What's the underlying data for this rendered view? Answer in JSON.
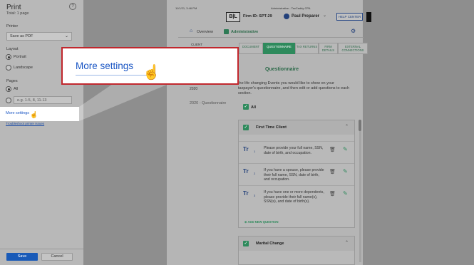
{
  "print_dialog": {
    "title": "Print",
    "total": "Total: 1 page",
    "help_icon": "?",
    "printer_label": "Printer",
    "printer_value": "Save as PDF",
    "layout_label": "Layout",
    "layout_options": [
      "Portrait",
      "Landscape"
    ],
    "layout_selected": "Portrait",
    "pages_label": "Pages",
    "pages_all": "All",
    "pages_placeholder": "e.g. 1-5, 8, 11-13",
    "more_settings": "More settings",
    "troubleshoot": "Troubleshoot printer issues",
    "save_label": "Save",
    "cancel_label": "Cancel"
  },
  "preview": {
    "header_date": "11/1/21, 3:46 PM",
    "header_title": "Administrative - TaxCaddy CPA",
    "logo": "B|L",
    "firm_id": "Firm ID: SPT-29",
    "user_name": "Paul Preparer",
    "help_center": "HELP CENTER",
    "nav": {
      "overview": "Overview",
      "administrative": "Administrative"
    },
    "client_label": "CLIENT",
    "tabs": [
      {
        "label": "DOCUMENT"
      },
      {
        "label": "QUESTIONNAIRE",
        "active": true
      },
      {
        "label": "TAX RETURNS"
      },
      {
        "label": "FIRM DETAILS"
      },
      {
        "label": "EXTERNAL CONNECTIONS"
      }
    ],
    "section_title": "Questionnaire",
    "intro": "the life changing Events you would like to show on your taxpayer's questionnaire, and then edit or add questions to each section.",
    "year_current": "2020",
    "year_questionnaire": "2020 - Questionnaire",
    "all_label": "All",
    "groups": [
      {
        "name": "First Time Client",
        "questions": [
          {
            "num": "1",
            "text": "Please provide your full name, SSN, date of birth, and occupation."
          },
          {
            "num": "2",
            "text": "If you have a spouse, please provide their full name, SSN, date of birth, and occupation."
          },
          {
            "num": "3",
            "text": "If you have one or more dependents, please provide their full name(s), SSN(s), and date of birth(s)."
          }
        ],
        "add_question": "ADD NEW QUESTION"
      },
      {
        "name": "Marital Change"
      }
    ]
  },
  "callout": {
    "text": "More settings"
  },
  "colors": {
    "accent_green": "#2e8a5c",
    "link_blue": "#1a56c4",
    "callout_border": "#c1272d"
  }
}
